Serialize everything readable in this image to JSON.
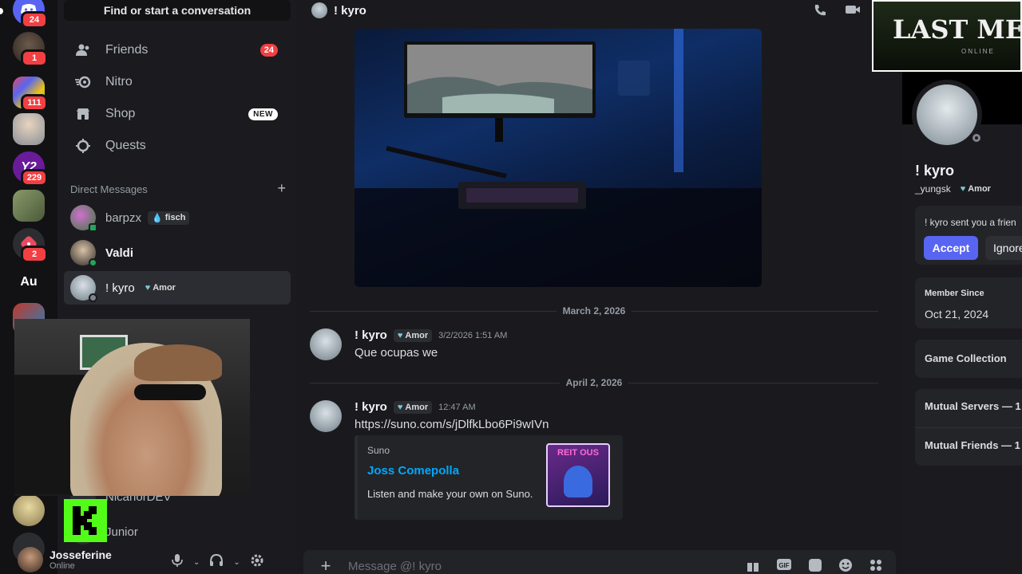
{
  "servers": [
    {
      "badge": "24",
      "color": "#5865f2",
      "glyph": ""
    },
    {
      "badge": "1",
      "color": "#3a3a3a",
      "glyph": ""
    },
    {
      "badge": "111",
      "color": "#8e44ad",
      "glyph": ""
    },
    {
      "badge": "",
      "color": "#9aa0a6",
      "glyph": ""
    },
    {
      "badge": "229",
      "color": "#6a1b9a",
      "glyph": "Y2"
    },
    {
      "badge": "",
      "color": "#6b7a56",
      "glyph": ""
    },
    {
      "badge": "2",
      "color": "#c4314b",
      "glyph": ""
    },
    {
      "badge": "",
      "color": "#2b2d31",
      "glyph": "Au"
    }
  ],
  "sidebar": {
    "search_label": "Find or start a conversation",
    "nav": [
      {
        "label": "Friends",
        "count": "24"
      },
      {
        "label": "Nitro"
      },
      {
        "label": "Shop",
        "tag": "NEW"
      },
      {
        "label": "Quests"
      }
    ],
    "dm_header": "Direct Messages",
    "dms": [
      {
        "name": "barpzx",
        "tag": "fisch",
        "status": "#23a55a"
      },
      {
        "name": "Valdi",
        "status": "#23a55a"
      },
      {
        "name": "! kyro",
        "tag": "Amor",
        "status": "#80848e"
      }
    ],
    "partial_dms": [
      "NicanorDEV",
      "Junior"
    ]
  },
  "user": {
    "name": "Josseferine",
    "status": "Online"
  },
  "chat": {
    "header_name": "! kyro",
    "dates": [
      "March 2, 2026",
      "April 2, 2026"
    ],
    "messages": [
      {
        "author": "! kyro",
        "tag": "Amor",
        "time": "3/2/2026 1:51 AM",
        "text": "Que ocupas we"
      },
      {
        "author": "! kyro",
        "tag": "Amor",
        "time": "12:47 AM",
        "link": "https://suno.com/s/jDlfkLbo6Pi9wIVn"
      }
    ],
    "embed": {
      "provider": "Suno",
      "title": "Joss Comepolla",
      "description": "Listen and make your own on Suno.",
      "thumb_text": "REIT OUS"
    },
    "composer_placeholder": "Message @! kyro"
  },
  "profile": {
    "banner_text": "LAST MEA",
    "banner_sub": "ONLINE",
    "display_name": "! kyro",
    "username": "_yungsk",
    "tag": "Amor",
    "friend_request": "! kyro sent you a frien",
    "accept_label": "Accept",
    "ignore_label": "Ignore",
    "member_since_label": "Member Since",
    "member_since_value": "Oct 21, 2024",
    "game_collection": "Game Collection",
    "mutual_servers": "Mutual Servers — 1",
    "mutual_friends": "Mutual Friends — 1"
  },
  "colors": {
    "accent": "#5865f2",
    "link": "#00a8fc",
    "danger": "#f23f43",
    "online": "#23a55a"
  }
}
